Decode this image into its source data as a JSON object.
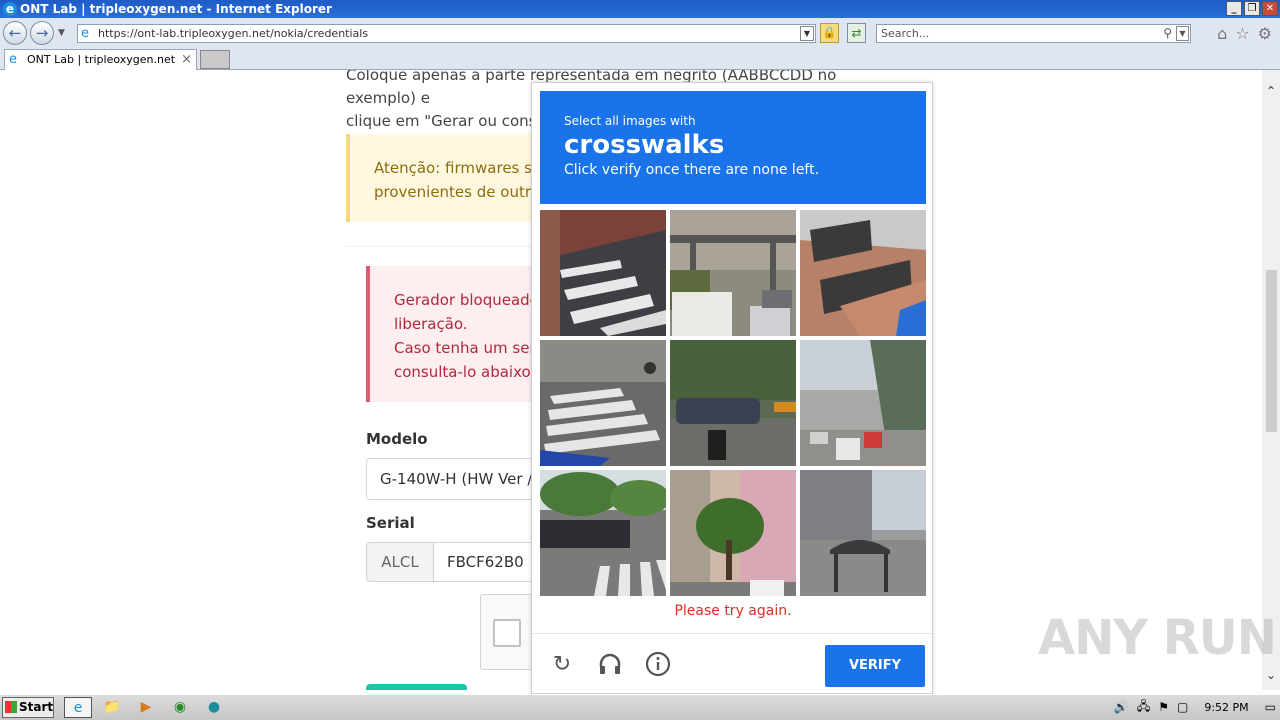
{
  "window": {
    "title": "ONT Lab | tripleoxygen.net - Internet Explorer",
    "controls": [
      "_",
      "❐",
      "✕"
    ]
  },
  "address_bar": {
    "url": "https://ont-lab.tripleoxygen.net/nokia/credentials",
    "search_placeholder": "Search..."
  },
  "tabs": [
    {
      "label": "ONT Lab | tripleoxygen.net"
    }
  ],
  "page": {
    "intro_line1": "Coloque apenas a parte representada em negrito (AABBCCDD no exemplo) e",
    "intro_line2": "clique em \"Gerar ou consu",
    "warning_line1": "Atenção: firmwares ser",
    "warning_line2": "provenientes de outro",
    "error_line1": "Gerador bloqueado",
    "error_line2": "liberação.",
    "error_line3": "Caso tenha um seria",
    "error_line4": "consulta-lo abaixo s",
    "model_label": "Modelo",
    "model_value": "G-140W-H (HW Ver /",
    "serial_label": "Serial",
    "serial_prefix": "ALCL",
    "serial_value": "FBCF62B0"
  },
  "captcha": {
    "instruction": "Select all images with",
    "target": "crosswalks",
    "hint": "Click verify once there are none left.",
    "error": "Please try again.",
    "verify_label": "VERIFY",
    "header_color": "#1a73e8",
    "tiles": [
      {
        "scene": "crosswalk-street-brick-wall"
      },
      {
        "scene": "gantry-van-traffic"
      },
      {
        "scene": "building-balcony"
      },
      {
        "scene": "crosswalk-cyclist"
      },
      {
        "scene": "car-motorcycle-trees"
      },
      {
        "scene": "overpass-traffic"
      },
      {
        "scene": "crosswalk-parked-bikes-trees"
      },
      {
        "scene": "tree-building-street"
      },
      {
        "scene": "building-bus-stop"
      }
    ]
  },
  "watermark": "ANY RUN",
  "taskbar": {
    "start_label": "Start",
    "clock": "9:52 PM"
  }
}
